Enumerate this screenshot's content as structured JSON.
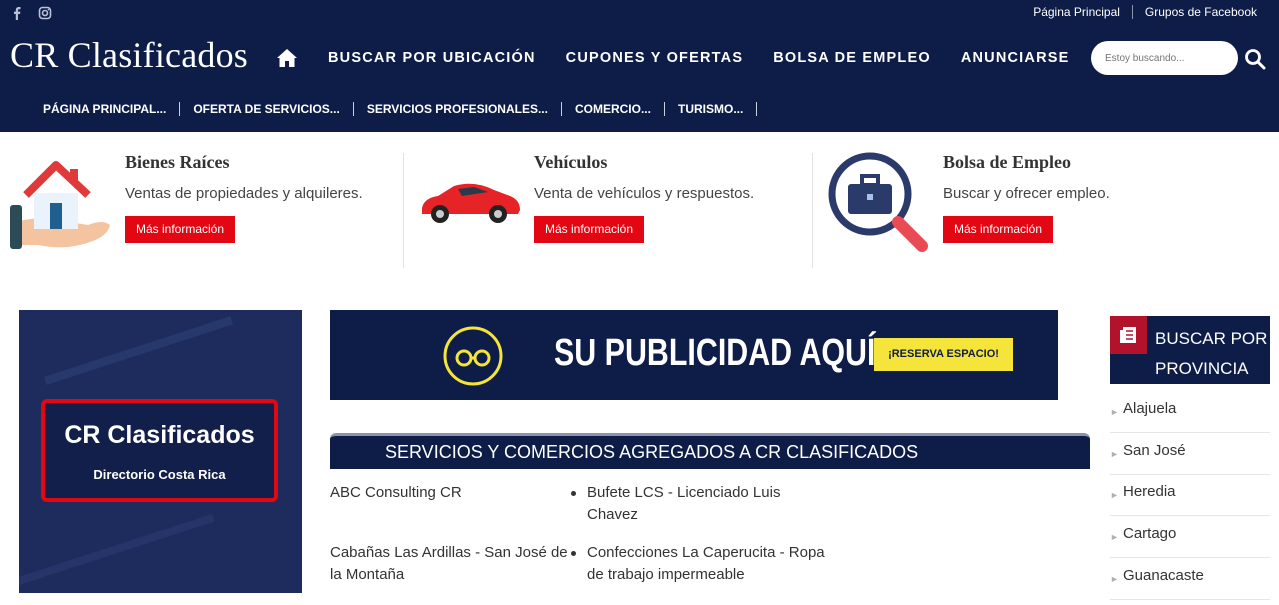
{
  "header": {
    "social": [
      "facebook-icon",
      "instagram-icon"
    ],
    "top_links": [
      "Página Principal",
      "Grupos de Facebook"
    ],
    "logo": "CR Clasificados",
    "main_nav": [
      "BUSCAR POR UBICACIÓN",
      "CUPONES Y OFERTAS",
      "BOLSA DE EMPLEO",
      "ANUNCIARSE"
    ],
    "search_placeholder": "Estoy buscando...",
    "sub_nav": [
      "PÁGINA PRINCIPAL...",
      "OFERTA DE SERVICIOS...",
      "SERVICIOS PROFESIONALES...",
      "COMERCIO...",
      "TURISMO..."
    ]
  },
  "features": [
    {
      "title": "Bienes Raíces",
      "desc": "Ventas de propiedades y alquileres.",
      "button": "Más información",
      "icon": "house-in-hand-icon"
    },
    {
      "title": "Vehículos",
      "desc": "Venta de vehículos y respuestos.",
      "button": "Más información",
      "icon": "red-car-icon"
    },
    {
      "title": "Bolsa de Empleo",
      "desc": "Buscar y ofrecer empleo.",
      "button": "Más información",
      "icon": "briefcase-magnifier-icon"
    }
  ],
  "promo": {
    "title": "CR Clasificados",
    "subtitle": "Directorio Costa Rica"
  },
  "banner": {
    "headline": "SU PUBLICIDAD AQUÍ",
    "cta": "¡RESERVA ESPACIO!"
  },
  "services": {
    "heading": "SERVICIOS Y COMERCIOS AGREGADOS A CR CLASIFICADOS",
    "col1": [
      [
        "ABC Consulting CR"
      ],
      [
        "Cabañas Las Ardillas - San José de",
        "la Montaña"
      ]
    ],
    "col2": [
      [
        "Bufete LCS - Licenciado Luis",
        "Chavez"
      ],
      [
        "Confecciones La Caperucita - Ropa",
        "de trabajo impermeable"
      ]
    ]
  },
  "provinces": {
    "heading_line1": "BUSCAR POR",
    "heading_line2": "PROVINCIA",
    "items": [
      "Alajuela",
      "San José",
      "Heredia",
      "Cartago",
      "Guanacaste"
    ]
  },
  "colors": {
    "navy": "#0e1c48",
    "red": "#e30613",
    "yellow": "#f5e43a"
  }
}
